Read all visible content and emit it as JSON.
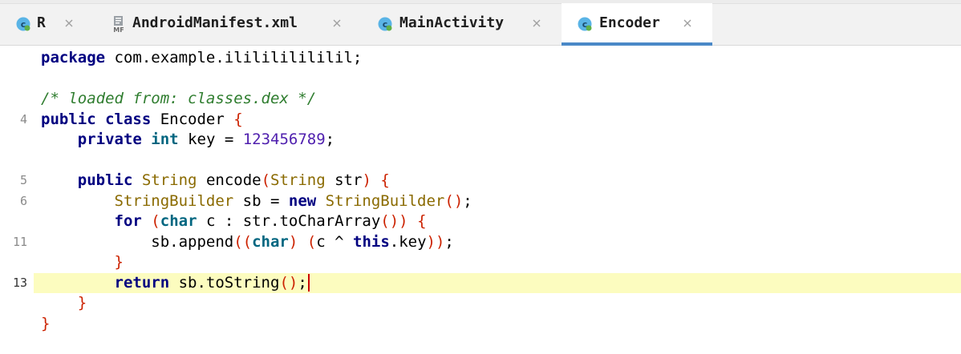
{
  "tabs": [
    {
      "label": "R",
      "icon": "class-icon",
      "active": false
    },
    {
      "label": "AndroidManifest.xml",
      "icon": "manifest-file-icon",
      "icon_text": "MF",
      "active": false
    },
    {
      "label": "MainActivity",
      "icon": "class-icon",
      "active": false
    },
    {
      "label": "Encoder",
      "icon": "class-icon",
      "active": true
    }
  ],
  "close_glyph": "×",
  "class_icon_letter": "c",
  "colors": {
    "accent": "#4a88c7",
    "current_line": "#fcfcbf",
    "keyword": "#000080",
    "type": "#8a6a00",
    "number": "#4f1fae",
    "comment": "#2f7d2f",
    "paren": "#cc2200"
  },
  "editor": {
    "lines": [
      {
        "number": "",
        "tokens": [
          {
            "t": "package",
            "c": "kw"
          },
          {
            "t": " com.example.ililililililil;",
            "c": ""
          }
        ]
      },
      {
        "number": "",
        "tokens": []
      },
      {
        "number": "",
        "tokens": [
          {
            "t": "/* loaded from: classes.dex */",
            "c": "comment"
          }
        ]
      },
      {
        "number": "4",
        "tokens": [
          {
            "t": "public class",
            "c": "kw"
          },
          {
            "t": " Encoder ",
            "c": ""
          },
          {
            "t": "{",
            "c": "paren"
          }
        ]
      },
      {
        "number": "",
        "tokens": [
          {
            "t": "    ",
            "c": ""
          },
          {
            "t": "private",
            "c": "kw"
          },
          {
            "t": " ",
            "c": ""
          },
          {
            "t": "int",
            "c": "prim"
          },
          {
            "t": " key = ",
            "c": ""
          },
          {
            "t": "123456789",
            "c": "num"
          },
          {
            "t": ";",
            "c": ""
          }
        ]
      },
      {
        "number": "",
        "tokens": []
      },
      {
        "number": "5",
        "tokens": [
          {
            "t": "    ",
            "c": ""
          },
          {
            "t": "public",
            "c": "kw"
          },
          {
            "t": " ",
            "c": ""
          },
          {
            "t": "String",
            "c": "type"
          },
          {
            "t": " encode",
            "c": ""
          },
          {
            "t": "(",
            "c": "paren"
          },
          {
            "t": "String",
            "c": "type"
          },
          {
            "t": " str",
            "c": ""
          },
          {
            "t": ")",
            "c": "paren"
          },
          {
            "t": " ",
            "c": ""
          },
          {
            "t": "{",
            "c": "paren"
          }
        ]
      },
      {
        "number": "6",
        "tokens": [
          {
            "t": "        ",
            "c": ""
          },
          {
            "t": "StringBuilder",
            "c": "type"
          },
          {
            "t": " sb = ",
            "c": ""
          },
          {
            "t": "new",
            "c": "kw"
          },
          {
            "t": " ",
            "c": ""
          },
          {
            "t": "StringBuilder",
            "c": "type"
          },
          {
            "t": "()",
            "c": "paren"
          },
          {
            "t": ";",
            "c": ""
          }
        ]
      },
      {
        "number": "",
        "tokens": [
          {
            "t": "        ",
            "c": ""
          },
          {
            "t": "for",
            "c": "kw"
          },
          {
            "t": " ",
            "c": ""
          },
          {
            "t": "(",
            "c": "paren"
          },
          {
            "t": "char",
            "c": "prim"
          },
          {
            "t": " c : str.toCharArray",
            "c": ""
          },
          {
            "t": "())",
            "c": "paren"
          },
          {
            "t": " ",
            "c": ""
          },
          {
            "t": "{",
            "c": "paren"
          }
        ]
      },
      {
        "number": "11",
        "tokens": [
          {
            "t": "            sb.append",
            "c": ""
          },
          {
            "t": "((",
            "c": "paren"
          },
          {
            "t": "char",
            "c": "prim"
          },
          {
            "t": ")",
            "c": "paren"
          },
          {
            "t": " ",
            "c": ""
          },
          {
            "t": "(",
            "c": "paren"
          },
          {
            "t": "c ^ ",
            "c": ""
          },
          {
            "t": "this",
            "c": "kw"
          },
          {
            "t": ".key",
            "c": ""
          },
          {
            "t": "))",
            "c": "paren"
          },
          {
            "t": ";",
            "c": ""
          }
        ]
      },
      {
        "number": "",
        "tokens": [
          {
            "t": "        ",
            "c": ""
          },
          {
            "t": "}",
            "c": "paren"
          }
        ]
      },
      {
        "number": "13",
        "current": true,
        "caret": true,
        "tokens": [
          {
            "t": "        ",
            "c": ""
          },
          {
            "t": "return",
            "c": "kw"
          },
          {
            "t": " sb.toString",
            "c": ""
          },
          {
            "t": "()",
            "c": "paren"
          },
          {
            "t": ";",
            "c": ""
          }
        ]
      },
      {
        "number": "",
        "tokens": [
          {
            "t": "    ",
            "c": ""
          },
          {
            "t": "}",
            "c": "paren"
          }
        ]
      },
      {
        "number": "",
        "tokens": [
          {
            "t": "}",
            "c": "paren"
          }
        ]
      }
    ]
  }
}
